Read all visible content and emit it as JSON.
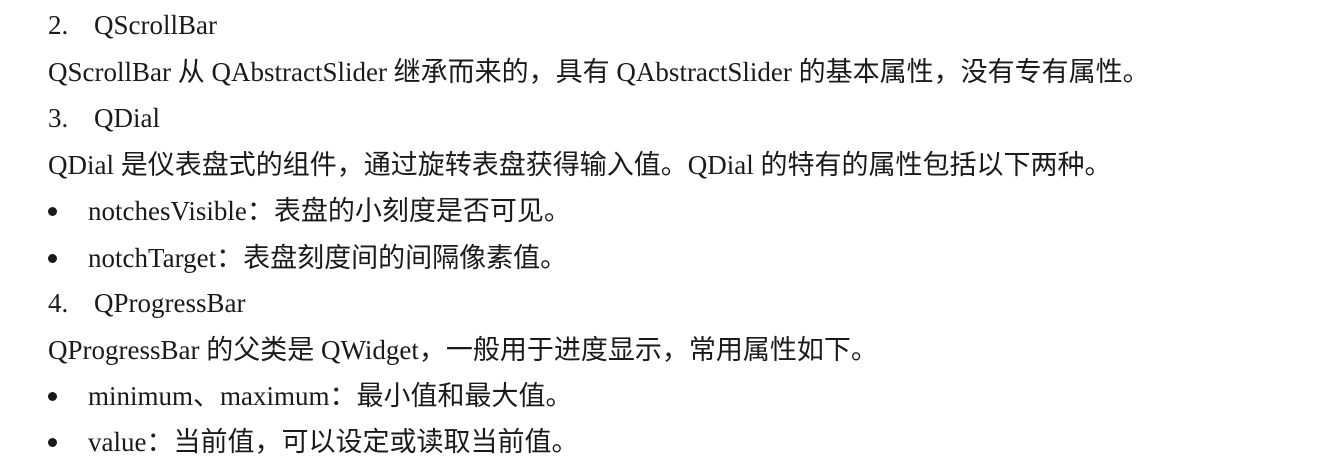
{
  "sections": [
    {
      "number": "2.",
      "title": "QScrollBar",
      "description": "QScrollBar 从 QAbstractSlider 继承而来的，具有 QAbstractSlider 的基本属性，没有专有属性。",
      "bullets": []
    },
    {
      "number": "3.",
      "title": "QDial",
      "description": "QDial 是仪表盘式的组件，通过旋转表盘获得输入值。QDial 的特有的属性包括以下两种。",
      "bullets": [
        "notchesVisible：表盘的小刻度是否可见。",
        "notchTarget：表盘刻度间的间隔像素值。"
      ]
    },
    {
      "number": "4.",
      "title": "QProgressBar",
      "description": "QProgressBar 的父类是 QWidget，一般用于进度显示，常用属性如下。",
      "bullets": [
        "minimum、maximum：最小值和最大值。",
        "value：当前值，可以设定或读取当前值。"
      ]
    }
  ]
}
